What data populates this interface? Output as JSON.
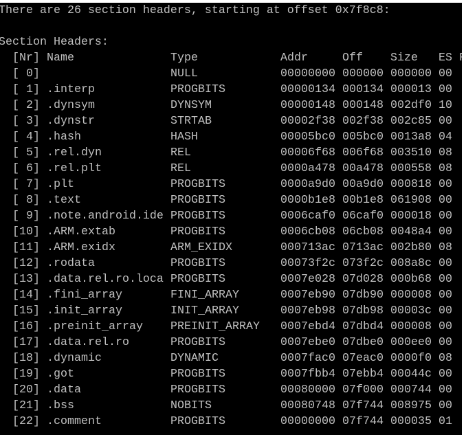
{
  "terminal": {
    "summary": "There are 26 section headers, starting at offset 0x7f8c8:",
    "section_title": "Section Headers:",
    "columns": {
      "nr": "[Nr]",
      "name": "Name",
      "type": "Type",
      "addr": "Addr",
      "off": "Off",
      "size": "Size",
      "es": "ES",
      "flg": "F"
    },
    "rows": [
      {
        "nr": "[ 0]",
        "name": "",
        "type": "NULL",
        "addr": "00000000",
        "off": "000000",
        "size": "000000",
        "es": "00"
      },
      {
        "nr": "[ 1]",
        "name": ".interp",
        "type": "PROGBITS",
        "addr": "00000134",
        "off": "000134",
        "size": "000013",
        "es": "00"
      },
      {
        "nr": "[ 2]",
        "name": ".dynsym",
        "type": "DYNSYM",
        "addr": "00000148",
        "off": "000148",
        "size": "002df0",
        "es": "10"
      },
      {
        "nr": "[ 3]",
        "name": ".dynstr",
        "type": "STRTAB",
        "addr": "00002f38",
        "off": "002f38",
        "size": "002c85",
        "es": "00"
      },
      {
        "nr": "[ 4]",
        "name": ".hash",
        "type": "HASH",
        "addr": "00005bc0",
        "off": "005bc0",
        "size": "0013a8",
        "es": "04"
      },
      {
        "nr": "[ 5]",
        "name": ".rel.dyn",
        "type": "REL",
        "addr": "00006f68",
        "off": "006f68",
        "size": "003510",
        "es": "08"
      },
      {
        "nr": "[ 6]",
        "name": ".rel.plt",
        "type": "REL",
        "addr": "0000a478",
        "off": "00a478",
        "size": "000558",
        "es": "08"
      },
      {
        "nr": "[ 7]",
        "name": ".plt",
        "type": "PROGBITS",
        "addr": "0000a9d0",
        "off": "00a9d0",
        "size": "000818",
        "es": "00"
      },
      {
        "nr": "[ 8]",
        "name": ".text",
        "type": "PROGBITS",
        "addr": "0000b1e8",
        "off": "00b1e8",
        "size": "061908",
        "es": "00"
      },
      {
        "nr": "[ 9]",
        "name": ".note.android.ide",
        "type": "PROGBITS",
        "addr": "0006caf0",
        "off": "06caf0",
        "size": "000018",
        "es": "00"
      },
      {
        "nr": "[10]",
        "name": ".ARM.extab",
        "type": "PROGBITS",
        "addr": "0006cb08",
        "off": "06cb08",
        "size": "0048a4",
        "es": "00"
      },
      {
        "nr": "[11]",
        "name": ".ARM.exidx",
        "type": "ARM_EXIDX",
        "addr": "000713ac",
        "off": "0713ac",
        "size": "002b80",
        "es": "08"
      },
      {
        "nr": "[12]",
        "name": ".rodata",
        "type": "PROGBITS",
        "addr": "00073f2c",
        "off": "073f2c",
        "size": "008a8c",
        "es": "00"
      },
      {
        "nr": "[13]",
        "name": ".data.rel.ro.loca",
        "type": "PROGBITS",
        "addr": "0007e028",
        "off": "07d028",
        "size": "000b68",
        "es": "00"
      },
      {
        "nr": "[14]",
        "name": ".fini_array",
        "type": "FINI_ARRAY",
        "addr": "0007eb90",
        "off": "07db90",
        "size": "000008",
        "es": "00"
      },
      {
        "nr": "[15]",
        "name": ".init_array",
        "type": "INIT_ARRAY",
        "addr": "0007eb98",
        "off": "07db98",
        "size": "00003c",
        "es": "00"
      },
      {
        "nr": "[16]",
        "name": ".preinit_array",
        "type": "PREINIT_ARRAY",
        "addr": "0007ebd4",
        "off": "07dbd4",
        "size": "000008",
        "es": "00"
      },
      {
        "nr": "[17]",
        "name": ".data.rel.ro",
        "type": "PROGBITS",
        "addr": "0007ebe0",
        "off": "07dbe0",
        "size": "000ee0",
        "es": "00"
      },
      {
        "nr": "[18]",
        "name": ".dynamic",
        "type": "DYNAMIC",
        "addr": "0007fac0",
        "off": "07eac0",
        "size": "0000f0",
        "es": "08"
      },
      {
        "nr": "[19]",
        "name": ".got",
        "type": "PROGBITS",
        "addr": "0007fbb4",
        "off": "07ebb4",
        "size": "00044c",
        "es": "00"
      },
      {
        "nr": "[20]",
        "name": ".data",
        "type": "PROGBITS",
        "addr": "00080000",
        "off": "07f000",
        "size": "000744",
        "es": "00"
      },
      {
        "nr": "[21]",
        "name": ".bss",
        "type": "NOBITS",
        "addr": "00080748",
        "off": "07f744",
        "size": "008975",
        "es": "00"
      },
      {
        "nr": "[22]",
        "name": ".comment",
        "type": "PROGBITS",
        "addr": "00000000",
        "off": "07f744",
        "size": "000035",
        "es": "01"
      }
    ]
  }
}
